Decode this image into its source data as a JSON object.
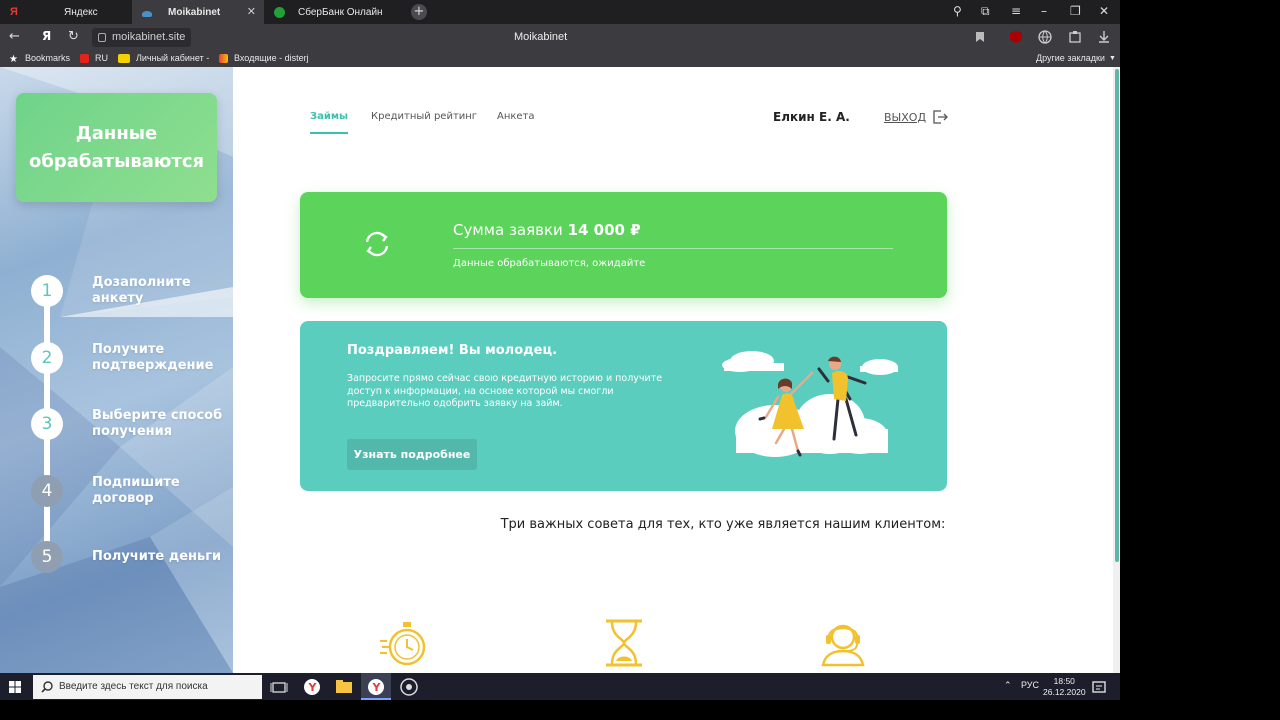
{
  "browser": {
    "tabs": [
      {
        "label": "Яндекс"
      },
      {
        "label": "Moikabinet"
      },
      {
        "label": "СберБанк Онлайн"
      }
    ],
    "url": "moikabinet.site",
    "title": "Moikabinet",
    "bookmarks": [
      {
        "label": "Bookmarks"
      },
      {
        "label": "RU"
      },
      {
        "label": "Личный кабинет -"
      },
      {
        "label": "Входящие - disterj"
      }
    ],
    "other_bookmarks": "Другие закладки"
  },
  "sidebar": {
    "status": "Данные обрабатываются",
    "steps": [
      {
        "num": "1",
        "label": "Дозаполните анкету"
      },
      {
        "num": "2",
        "label": "Получите подтверждение"
      },
      {
        "num": "3",
        "label": "Выберите способ получения"
      },
      {
        "num": "4",
        "label": "Подпишите договор"
      },
      {
        "num": "5",
        "label": "Получите деньги"
      }
    ]
  },
  "header": {
    "tabs": [
      {
        "label": "Займы"
      },
      {
        "label": "Кредитный рейтинг"
      },
      {
        "label": "Анкета"
      }
    ],
    "user": "Елкин Е. А.",
    "logout": "ВЫХОД"
  },
  "application": {
    "title_prefix": "Сумма заявки",
    "amount": "14 000 ₽",
    "status": "Данные обрабатываются, ожидайте"
  },
  "promo": {
    "title": "Поздравляем! Вы молодец.",
    "text": "Запросите прямо сейчас свою кредитную историю и получите доступ к информации, на основе которой мы смогли предварительно одобрить заявку на займ.",
    "button": "Узнать подробнее"
  },
  "tips": {
    "title": "Три важных совета для тех, кто уже является нашим клиентом:"
  },
  "taskbar": {
    "search_placeholder": "Введите здесь текст для поиска",
    "lang": "РУС",
    "time": "18:50",
    "date": "26.12.2020"
  },
  "colors": {
    "accent": "#3cbfae",
    "green": "#5cd35a",
    "teal": "#5bcdbf",
    "gold": "#f2c12e"
  }
}
